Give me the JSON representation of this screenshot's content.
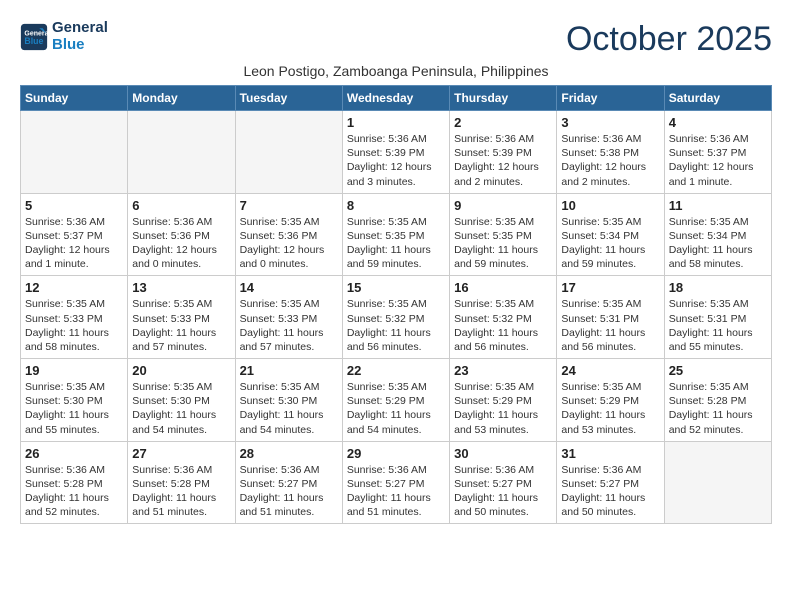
{
  "logo": {
    "line1": "General",
    "line2": "Blue"
  },
  "title": "October 2025",
  "subtitle": "Leon Postigo, Zamboanga Peninsula, Philippines",
  "weekdays": [
    "Sunday",
    "Monday",
    "Tuesday",
    "Wednesday",
    "Thursday",
    "Friday",
    "Saturday"
  ],
  "weeks": [
    [
      {
        "day": "",
        "info": ""
      },
      {
        "day": "",
        "info": ""
      },
      {
        "day": "",
        "info": ""
      },
      {
        "day": "1",
        "info": "Sunrise: 5:36 AM\nSunset: 5:39 PM\nDaylight: 12 hours and 3 minutes."
      },
      {
        "day": "2",
        "info": "Sunrise: 5:36 AM\nSunset: 5:39 PM\nDaylight: 12 hours and 2 minutes."
      },
      {
        "day": "3",
        "info": "Sunrise: 5:36 AM\nSunset: 5:38 PM\nDaylight: 12 hours and 2 minutes."
      },
      {
        "day": "4",
        "info": "Sunrise: 5:36 AM\nSunset: 5:37 PM\nDaylight: 12 hours and 1 minute."
      }
    ],
    [
      {
        "day": "5",
        "info": "Sunrise: 5:36 AM\nSunset: 5:37 PM\nDaylight: 12 hours and 1 minute."
      },
      {
        "day": "6",
        "info": "Sunrise: 5:36 AM\nSunset: 5:36 PM\nDaylight: 12 hours and 0 minutes."
      },
      {
        "day": "7",
        "info": "Sunrise: 5:35 AM\nSunset: 5:36 PM\nDaylight: 12 hours and 0 minutes."
      },
      {
        "day": "8",
        "info": "Sunrise: 5:35 AM\nSunset: 5:35 PM\nDaylight: 11 hours and 59 minutes."
      },
      {
        "day": "9",
        "info": "Sunrise: 5:35 AM\nSunset: 5:35 PM\nDaylight: 11 hours and 59 minutes."
      },
      {
        "day": "10",
        "info": "Sunrise: 5:35 AM\nSunset: 5:34 PM\nDaylight: 11 hours and 59 minutes."
      },
      {
        "day": "11",
        "info": "Sunrise: 5:35 AM\nSunset: 5:34 PM\nDaylight: 11 hours and 58 minutes."
      }
    ],
    [
      {
        "day": "12",
        "info": "Sunrise: 5:35 AM\nSunset: 5:33 PM\nDaylight: 11 hours and 58 minutes."
      },
      {
        "day": "13",
        "info": "Sunrise: 5:35 AM\nSunset: 5:33 PM\nDaylight: 11 hours and 57 minutes."
      },
      {
        "day": "14",
        "info": "Sunrise: 5:35 AM\nSunset: 5:33 PM\nDaylight: 11 hours and 57 minutes."
      },
      {
        "day": "15",
        "info": "Sunrise: 5:35 AM\nSunset: 5:32 PM\nDaylight: 11 hours and 56 minutes."
      },
      {
        "day": "16",
        "info": "Sunrise: 5:35 AM\nSunset: 5:32 PM\nDaylight: 11 hours and 56 minutes."
      },
      {
        "day": "17",
        "info": "Sunrise: 5:35 AM\nSunset: 5:31 PM\nDaylight: 11 hours and 56 minutes."
      },
      {
        "day": "18",
        "info": "Sunrise: 5:35 AM\nSunset: 5:31 PM\nDaylight: 11 hours and 55 minutes."
      }
    ],
    [
      {
        "day": "19",
        "info": "Sunrise: 5:35 AM\nSunset: 5:30 PM\nDaylight: 11 hours and 55 minutes."
      },
      {
        "day": "20",
        "info": "Sunrise: 5:35 AM\nSunset: 5:30 PM\nDaylight: 11 hours and 54 minutes."
      },
      {
        "day": "21",
        "info": "Sunrise: 5:35 AM\nSunset: 5:30 PM\nDaylight: 11 hours and 54 minutes."
      },
      {
        "day": "22",
        "info": "Sunrise: 5:35 AM\nSunset: 5:29 PM\nDaylight: 11 hours and 54 minutes."
      },
      {
        "day": "23",
        "info": "Sunrise: 5:35 AM\nSunset: 5:29 PM\nDaylight: 11 hours and 53 minutes."
      },
      {
        "day": "24",
        "info": "Sunrise: 5:35 AM\nSunset: 5:29 PM\nDaylight: 11 hours and 53 minutes."
      },
      {
        "day": "25",
        "info": "Sunrise: 5:35 AM\nSunset: 5:28 PM\nDaylight: 11 hours and 52 minutes."
      }
    ],
    [
      {
        "day": "26",
        "info": "Sunrise: 5:36 AM\nSunset: 5:28 PM\nDaylight: 11 hours and 52 minutes."
      },
      {
        "day": "27",
        "info": "Sunrise: 5:36 AM\nSunset: 5:28 PM\nDaylight: 11 hours and 51 minutes."
      },
      {
        "day": "28",
        "info": "Sunrise: 5:36 AM\nSunset: 5:27 PM\nDaylight: 11 hours and 51 minutes."
      },
      {
        "day": "29",
        "info": "Sunrise: 5:36 AM\nSunset: 5:27 PM\nDaylight: 11 hours and 51 minutes."
      },
      {
        "day": "30",
        "info": "Sunrise: 5:36 AM\nSunset: 5:27 PM\nDaylight: 11 hours and 50 minutes."
      },
      {
        "day": "31",
        "info": "Sunrise: 5:36 AM\nSunset: 5:27 PM\nDaylight: 11 hours and 50 minutes."
      },
      {
        "day": "",
        "info": ""
      }
    ]
  ]
}
